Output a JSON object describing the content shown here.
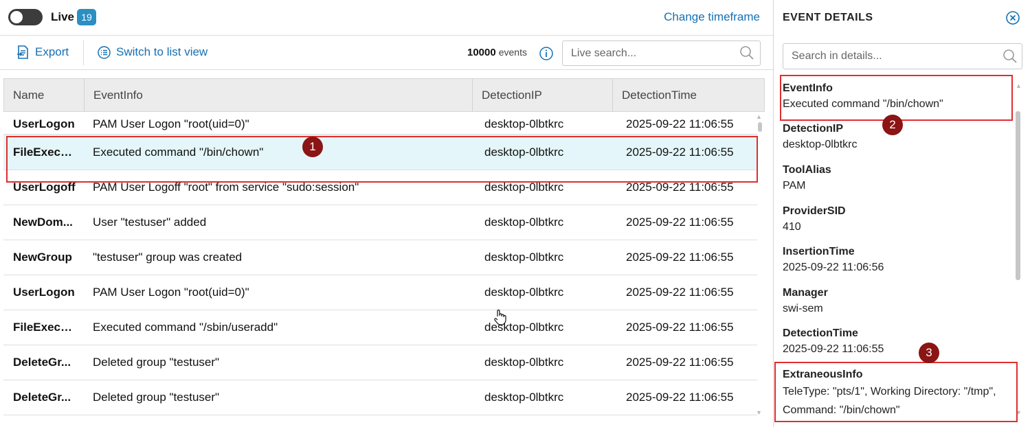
{
  "topbar": {
    "live_label": "Live",
    "live_count": "19",
    "change_timeframe": "Change timeframe"
  },
  "toolbar": {
    "export_label": "Export",
    "switch_label": "Switch to list view",
    "event_count": "10000",
    "event_unit": "events",
    "search_placeholder": "Live search..."
  },
  "table": {
    "columns": [
      "Name",
      "EventInfo",
      "DetectionIP",
      "DetectionTime"
    ],
    "rows": [
      {
        "name": "UserLogon",
        "info": "PAM User Logon \"root(uid=0)\"",
        "ip": "desktop-0lbtkrc",
        "time": "2025-09-22 11:06:55"
      },
      {
        "name": "FileExecute",
        "info": "Executed command \"/bin/chown\"",
        "ip": "desktop-0lbtkrc",
        "time": "2025-09-22 11:06:55"
      },
      {
        "name": "UserLogoff",
        "info": "PAM User Logoff \"root\" from service \"sudo:session\"",
        "ip": "desktop-0lbtkrc",
        "time": "2025-09-22 11:06:55"
      },
      {
        "name": "NewDom...",
        "info": "User \"testuser\" added",
        "ip": "desktop-0lbtkrc",
        "time": "2025-09-22 11:06:55"
      },
      {
        "name": "NewGroup",
        "info": "\"testuser\" group was created",
        "ip": "desktop-0lbtkrc",
        "time": "2025-09-22 11:06:55"
      },
      {
        "name": "UserLogon",
        "info": "PAM User Logon \"root(uid=0)\"",
        "ip": "desktop-0lbtkrc",
        "time": "2025-09-22 11:06:55"
      },
      {
        "name": "FileExecute",
        "info": "Executed command \"/sbin/useradd\"",
        "ip": "desktop-0lbtkrc",
        "time": "2025-09-22 11:06:55"
      },
      {
        "name": "DeleteGr...",
        "info": "Deleted group \"testuser\"",
        "ip": "desktop-0lbtkrc",
        "time": "2025-09-22 11:06:55"
      },
      {
        "name": "DeleteGr...",
        "info": "Deleted group \"testuser\"",
        "ip": "desktop-0lbtkrc",
        "time": "2025-09-22 11:06:55"
      }
    ]
  },
  "side": {
    "title": "EVENT DETAILS",
    "search_placeholder": "Search in details...",
    "details": [
      {
        "key": "EventInfo",
        "value": "Executed command \"/bin/chown\""
      },
      {
        "key": "DetectionIP",
        "value": "desktop-0lbtkrc"
      },
      {
        "key": "ToolAlias",
        "value": "PAM"
      },
      {
        "key": "ProviderSID",
        "value": "410"
      },
      {
        "key": "InsertionTime",
        "value": "2025-09-22 11:06:56"
      },
      {
        "key": "Manager",
        "value": "swi-sem"
      },
      {
        "key": "DetectionTime",
        "value": "2025-09-22 11:06:55"
      },
      {
        "key": "ExtraneousInfo",
        "value": "TeleType: \"pts/1\", Working Directory: \"/tmp\", Command: \"/bin/chown\""
      }
    ]
  },
  "markers": [
    "1",
    "2",
    "3"
  ],
  "colors": {
    "accent": "#1670b3",
    "badge": "#2b8fc2",
    "selected_row": "#e4f6f9",
    "highlight": "#e02d2d",
    "marker": "#8b1414"
  }
}
